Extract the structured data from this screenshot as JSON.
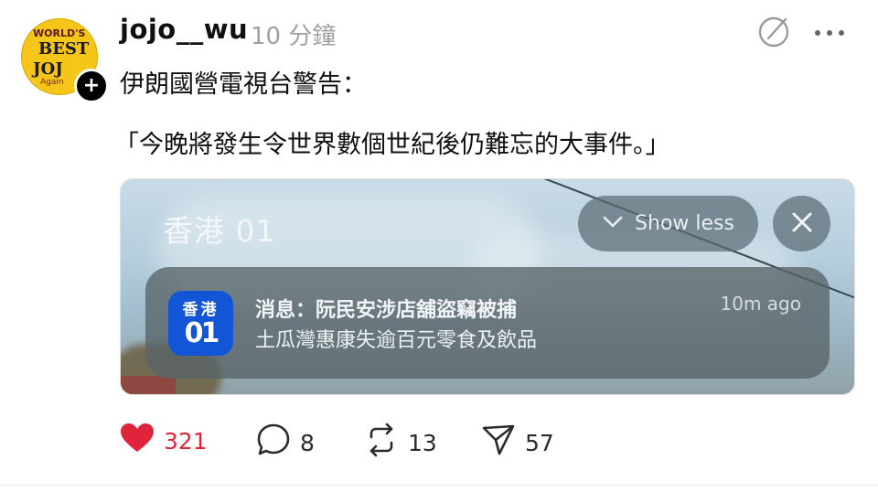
{
  "post": {
    "username": "jojo__wu",
    "time": "10 分鐘",
    "avatar_lines": [
      "WORLD'S",
      "BEST",
      "JOJ",
      "Again"
    ],
    "line1": "伊朗國營電視台警告：",
    "line2": "「今晚將發生令世界數個世紀後仍難忘的大事件。」"
  },
  "card": {
    "app_title": "香港 01",
    "show_less_label": "Show less",
    "notification": {
      "icon_top": "香港",
      "icon_bottom": "01",
      "title": "消息：阮民安涉店舖盜竊被捕",
      "body": "土瓜灣惠康失逾百元零食及飲品",
      "time": "10m ago"
    }
  },
  "actions": {
    "likes": "321",
    "comments": "8",
    "reposts": "13",
    "shares": "57"
  },
  "colors": {
    "like": "#e0243c",
    "app_icon_bg": "#1255d6"
  }
}
